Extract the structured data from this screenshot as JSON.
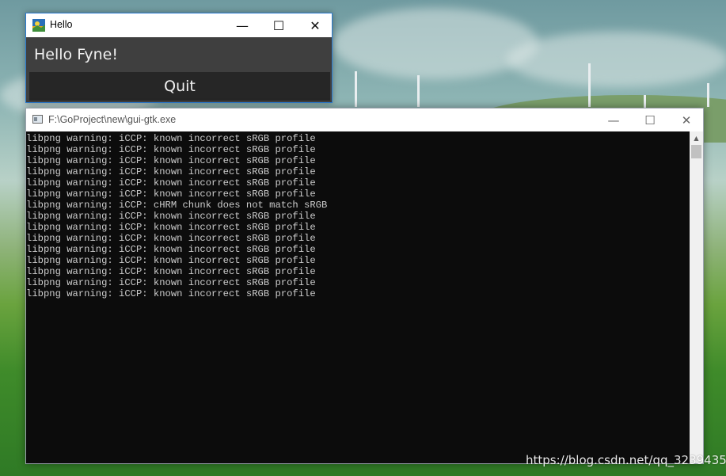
{
  "desktop": {
    "watermark": "https://blog.csdn.net/qq_32394351"
  },
  "fyne_window": {
    "title": "Hello",
    "minimize_glyph": "—",
    "maximize_glyph": "☐",
    "close_glyph": "✕",
    "label": "Hello Fyne!",
    "quit_label": "Quit"
  },
  "console_window": {
    "title": "F:\\GoProject\\new\\gui-gtk.exe",
    "minimize_glyph": "—",
    "maximize_glyph": "☐",
    "close_glyph": "✕",
    "scroll_up_glyph": "▲",
    "lines": [
      "libpng warning: iCCP: known incorrect sRGB profile",
      "libpng warning: iCCP: known incorrect sRGB profile",
      "libpng warning: iCCP: known incorrect sRGB profile",
      "libpng warning: iCCP: known incorrect sRGB profile",
      "libpng warning: iCCP: known incorrect sRGB profile",
      "libpng warning: iCCP: known incorrect sRGB profile",
      "libpng warning: iCCP: cHRM chunk does not match sRGB",
      "libpng warning: iCCP: known incorrect sRGB profile",
      "libpng warning: iCCP: known incorrect sRGB profile",
      "libpng warning: iCCP: known incorrect sRGB profile",
      "libpng warning: iCCP: known incorrect sRGB profile",
      "libpng warning: iCCP: known incorrect sRGB profile",
      "libpng warning: iCCP: known incorrect sRGB profile",
      "libpng warning: iCCP: known incorrect sRGB profile",
      "libpng warning: iCCP: known incorrect sRGB profile"
    ]
  }
}
